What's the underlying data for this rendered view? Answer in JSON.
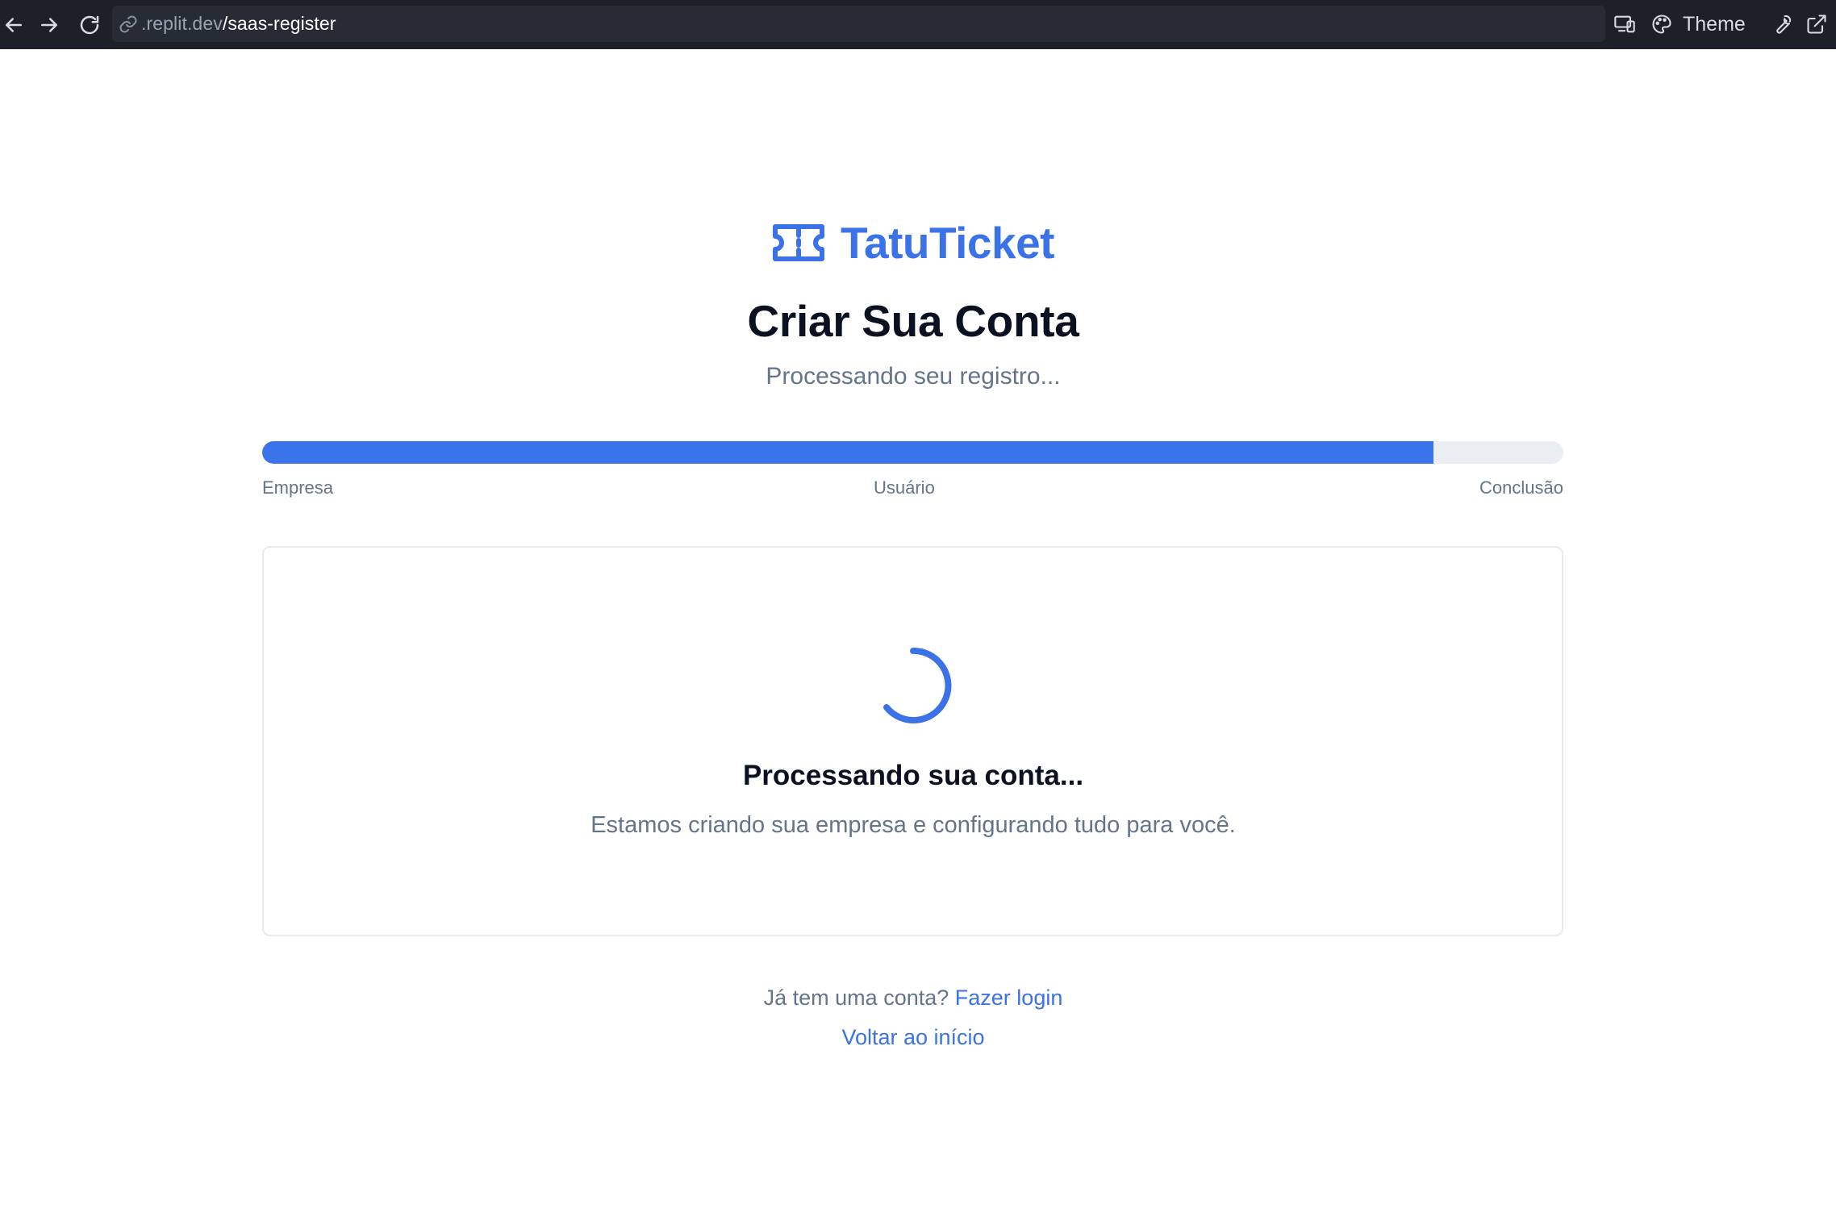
{
  "browser": {
    "url_host": ".replit.dev",
    "url_path": "/saas-register",
    "theme_label": "Theme"
  },
  "brand": {
    "name": "TatuTicket",
    "accent_color": "#3b72e8",
    "logo_icon": "ticket-icon"
  },
  "header": {
    "title": "Criar Sua Conta",
    "subtitle": "Processando seu registro..."
  },
  "progress": {
    "value": 0.9,
    "steps": [
      "Empresa",
      "Usuário",
      "Conclusão"
    ]
  },
  "status_card": {
    "icon": "loading-spinner-icon",
    "title": "Processando sua conta...",
    "message": "Estamos criando sua empresa e configurando tudo para você."
  },
  "footer": {
    "prompt": "Já tem uma conta?",
    "login_link": "Fazer login",
    "home_link": "Voltar ao início"
  }
}
